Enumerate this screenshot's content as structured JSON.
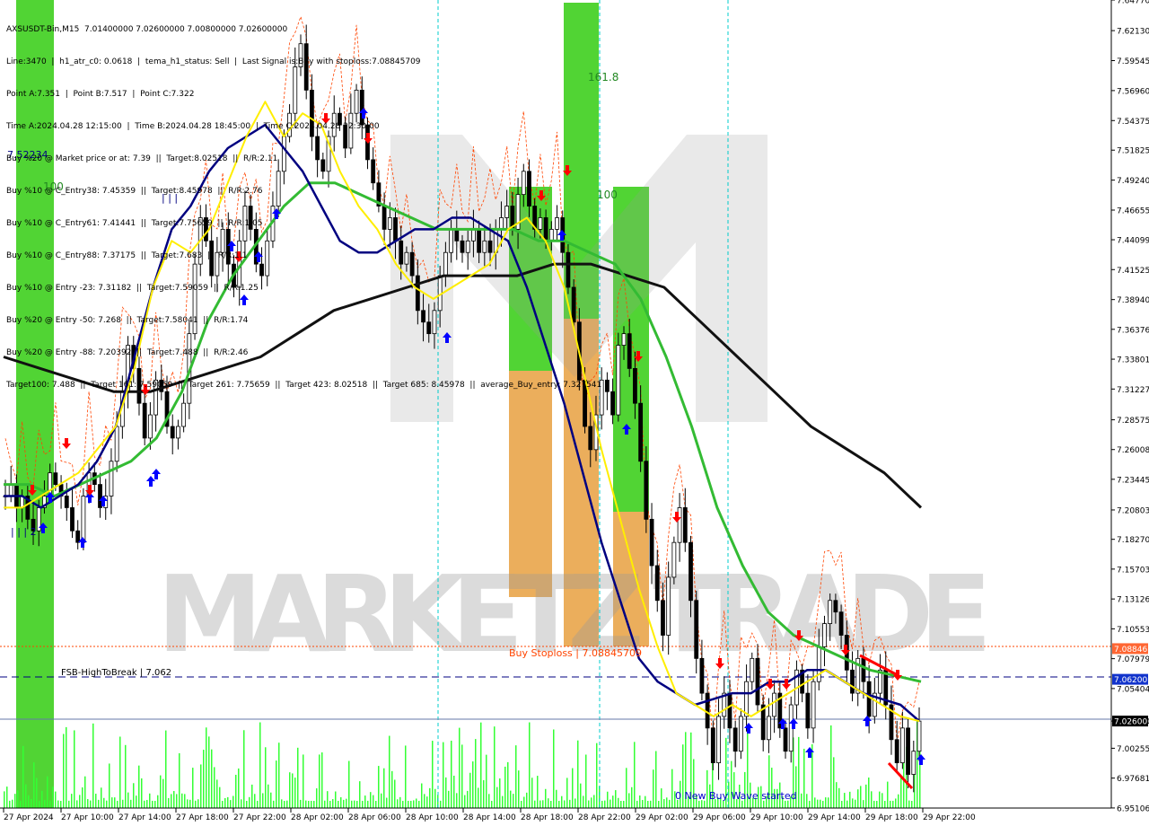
{
  "header": {
    "lines": [
      "AXSUSDT-Bin,M15  7.01400000 7.02600000 7.00800000 7.02600000",
      "Line:3470  |  h1_atr_c0: 0.0618  |  tema_h1_status: Sell  |  Last Signal is:Buy with stoploss:7.08845709",
      "Point A:7.351  |  Point B:7.517  |  Point C:7.322",
      "Time A:2024.04.28 12:15:00  |  Time B:2024.04.28 18:45:00  |  Time C:2024.04.28 22:30:00",
      "Buy %20 @ Market price or at: 7.39  ||  Target:8.02518  ||  R/R:2.11",
      "Buy %10 @ C_Entry38: 7.45359  ||  Target:8.45978  ||  R/R:2.76",
      "Buy %10 @ C_Entry61: 7.41441  ||  Target:7.75659  ||  R/R:1.05",
      "Buy %10 @ C_Entry88: 7.37175  ||  Target:7.683  ||  R/R:1.1",
      "Buy %10 @ Entry -23: 7.31182  ||  Target:7.59059  ||  R/R:1.25",
      "Buy %20 @ Entry -50: 7.268  ||  Target:7.58041  ||  R/R:1.74",
      "Buy %20 @ Entry -88: 7.20392  ||  Target:7.488  ||  R/R:2.46",
      "Target100: 7.488  ||  Target 161: 7.59059  ||  Target 261: 7.75659  ||  Target 423: 8.02518  ||  Target 685: 8.45978  ||  average_Buy_entry: 7.327541"
    ]
  },
  "labels": {
    "level_high": "7.52234",
    "fib_100_left": "100",
    "fib_100_right": "100",
    "fib_1618": "161.8",
    "fsb": "FSB-HighToBreak  |  7.062",
    "buy_stoploss": "Buy Stoploss  |  7.08845709",
    "wave": "0 New Buy Wave started",
    "watermark": "MARKETZ TRADE",
    "bars_marks": "| | |",
    "bars_marks2": "| | | 2"
  },
  "colors": {
    "bull_zone": "#33cc11",
    "bear_zone": "#e8a040",
    "ema_yellow": "#ffee00",
    "ema_navy": "#000080",
    "ema_green": "#33bb33",
    "ema_black": "#111111",
    "sell_arrow": "#ff0000",
    "buy_arrow": "#0000ff",
    "orange_line": "#ff4400",
    "fsb_line": "#000080",
    "cyan_line": "#00cccc",
    "volume": "#33ff33",
    "stoploss_badge": "#ff6633",
    "fsb_badge": "#1133cc",
    "price_badge": "#000000"
  },
  "chart_data": {
    "type": "candlestick",
    "symbol": "AXSUSDT-Bin",
    "timeframe": "M15",
    "ylim": [
      6.951,
      7.6477
    ],
    "y_ticks": [
      "7.64770",
      "7.62130",
      "7.59545",
      "7.56960",
      "7.54375",
      "7.51825",
      "7.49240",
      "7.46655",
      "7.44099",
      "7.41525",
      "7.38940",
      "7.36376",
      "7.33801",
      "7.31227",
      "7.28575",
      "7.26008",
      "7.23445",
      "7.20803",
      "7.18270",
      "7.15703",
      "7.13126",
      "7.10553",
      "7.07979",
      "7.05404",
      "7.02600",
      "7.00255",
      "6.97681",
      "6.95106"
    ],
    "x_ticks": [
      "27 Apr 2024",
      "27 Apr 10:00",
      "27 Apr 14:00",
      "27 Apr 18:00",
      "27 Apr 22:00",
      "28 Apr 02:00",
      "28 Apr 06:00",
      "28 Apr 10:00",
      "28 Apr 14:00",
      "28 Apr 18:00",
      "28 Apr 22:00",
      "29 Apr 02:00",
      "29 Apr 06:00",
      "29 Apr 10:00",
      "29 Apr 14:00",
      "29 Apr 18:00",
      "29 Apr 22:00"
    ],
    "close_series": [
      7.22,
      7.23,
      7.21,
      7.22,
      7.2,
      7.19,
      7.21,
      7.22,
      7.24,
      7.23,
      7.22,
      7.21,
      7.19,
      7.18,
      7.22,
      7.24,
      7.23,
      7.21,
      7.22,
      7.25,
      7.28,
      7.31,
      7.35,
      7.33,
      7.3,
      7.27,
      7.29,
      7.32,
      7.31,
      7.28,
      7.27,
      7.28,
      7.3,
      7.36,
      7.42,
      7.46,
      7.44,
      7.41,
      7.43,
      7.45,
      7.42,
      7.4,
      7.44,
      7.47,
      7.45,
      7.42,
      7.41,
      7.44,
      7.47,
      7.5,
      7.53,
      7.55,
      7.59,
      7.61,
      7.57,
      7.53,
      7.51,
      7.5,
      7.53,
      7.55,
      7.54,
      7.52,
      7.55,
      7.57,
      7.54,
      7.51,
      7.49,
      7.47,
      7.45,
      7.46,
      7.44,
      7.42,
      7.43,
      7.41,
      7.38,
      7.37,
      7.36,
      7.38,
      7.41,
      7.43,
      7.45,
      7.44,
      7.43,
      7.44,
      7.45,
      7.43,
      7.44,
      7.43,
      7.45,
      7.46,
      7.47,
      7.45,
      7.48,
      7.5,
      7.47,
      7.45,
      7.46,
      7.44,
      7.45,
      7.46,
      7.43,
      7.4,
      7.37,
      7.32,
      7.28,
      7.26,
      7.29,
      7.32,
      7.31,
      7.29,
      7.35,
      7.36,
      7.33,
      7.3,
      7.25,
      7.2,
      7.16,
      7.13,
      7.1,
      7.15,
      7.18,
      7.21,
      7.18,
      7.13,
      7.08,
      7.05,
      7.02,
      6.99,
      7.03,
      7.05,
      7.02,
      7.0,
      7.03,
      7.06,
      7.08,
      7.04,
      7.01,
      7.03,
      7.05,
      7.02,
      7.0,
      7.04,
      7.07,
      7.05,
      7.02,
      7.06,
      7.09,
      7.11,
      7.13,
      7.12,
      7.1,
      7.07,
      7.05,
      7.08,
      7.06,
      7.03,
      7.05,
      7.07,
      7.04,
      7.01,
      6.99,
      7.02,
      6.98,
      7.0,
      7.026
    ],
    "ema_yellow": [
      7.21,
      7.21,
      7.22,
      7.23,
      7.24,
      7.26,
      7.28,
      7.33,
      7.4,
      7.44,
      7.43,
      7.45,
      7.49,
      7.53,
      7.56,
      7.53,
      7.55,
      7.54,
      7.5,
      7.47,
      7.45,
      7.42,
      7.4,
      7.39,
      7.4,
      7.41,
      7.42,
      7.45,
      7.46,
      7.44,
      7.4,
      7.33,
      7.26,
      7.2,
      7.14,
      7.09,
      7.05,
      7.04,
      7.03,
      7.04,
      7.03,
      7.04,
      7.05,
      7.06,
      7.07,
      7.06,
      7.05,
      7.04,
      7.03,
      7.026
    ],
    "ema_navy": [
      7.22,
      7.22,
      7.21,
      7.22,
      7.23,
      7.25,
      7.28,
      7.34,
      7.4,
      7.45,
      7.47,
      7.5,
      7.52,
      7.53,
      7.54,
      7.52,
      7.5,
      7.47,
      7.44,
      7.43,
      7.43,
      7.44,
      7.45,
      7.45,
      7.46,
      7.46,
      7.45,
      7.44,
      7.4,
      7.35,
      7.3,
      7.24,
      7.18,
      7.13,
      7.08,
      7.06,
      7.05,
      7.04,
      7.045,
      7.05,
      7.05,
      7.06,
      7.06,
      7.07,
      7.07,
      7.06,
      7.05,
      7.045,
      7.04,
      7.026
    ],
    "ema_green": [
      7.23,
      7.23,
      7.22,
      7.23,
      7.24,
      7.25,
      7.27,
      7.31,
      7.37,
      7.41,
      7.44,
      7.47,
      7.49,
      7.49,
      7.48,
      7.47,
      7.46,
      7.45,
      7.45,
      7.45,
      7.45,
      7.44,
      7.44,
      7.43,
      7.42,
      7.39,
      7.34,
      7.28,
      7.21,
      7.16,
      7.12,
      7.1,
      7.09,
      7.08,
      7.07,
      7.065,
      7.06
    ],
    "ema_black": [
      7.34,
      7.33,
      7.32,
      7.31,
      7.31,
      7.32,
      7.33,
      7.34,
      7.36,
      7.38,
      7.39,
      7.4,
      7.41,
      7.41,
      7.41,
      7.42,
      7.42,
      7.41,
      7.4,
      7.37,
      7.34,
      7.31,
      7.28,
      7.26,
      7.24,
      7.21
    ],
    "levels": [
      {
        "name": "Buy Stoploss",
        "value": 7.08845709
      },
      {
        "name": "FSB-HighToBreak",
        "value": 7.062
      },
      {
        "name": "last price",
        "value": 7.026
      }
    ]
  }
}
